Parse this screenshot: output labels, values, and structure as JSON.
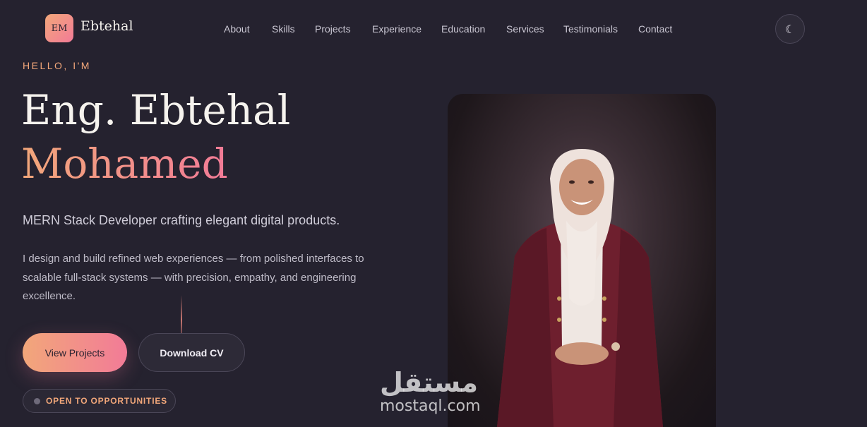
{
  "brand": {
    "initials": "EM",
    "name": "Ebtehal"
  },
  "nav": {
    "items": [
      {
        "label": "About"
      },
      {
        "label": "Skills"
      },
      {
        "label": "Projects"
      },
      {
        "label": "Experience"
      },
      {
        "label": "Education"
      },
      {
        "label": "Services"
      },
      {
        "label": "Testimonials"
      },
      {
        "label": "Contact"
      }
    ]
  },
  "theme_toggle": {
    "icon": "moon-icon",
    "glyph": "☾"
  },
  "hero": {
    "eyebrow": "HELLO, I'M",
    "name_first": "Eng. Ebtehal",
    "name_last": "Mohamed",
    "tagline": "MERN Stack Developer crafting elegant digital products.",
    "bio": "I design and build refined web experiences — from polished interfaces to scalable full-stack systems — with precision, empathy, and engineering excellence.",
    "primary_cta": "View Projects",
    "secondary_cta": "Download CV",
    "status": "OPEN TO OPPORTUNITIES"
  },
  "watermark": {
    "arabic": "مستقل",
    "latin": "mostaql.com"
  },
  "colors": {
    "background": "#25222f",
    "accent_start": "#f2a77a",
    "accent_end": "#f27b97",
    "text_primary": "#f6f3ee",
    "text_muted": "#bfbcc8"
  }
}
